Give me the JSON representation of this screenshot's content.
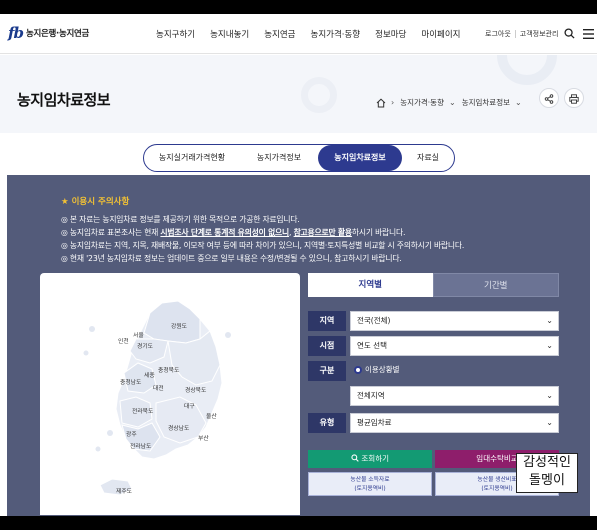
{
  "header": {
    "logo_mark": "fb",
    "logo_text": "농지은행·농지연금",
    "nav": [
      "농지구하기",
      "농지내놓기",
      "농지연금",
      "농지가격·동향",
      "정보마당",
      "마이페이지"
    ],
    "util": {
      "login": "로그아웃",
      "customer": "고객정보관리"
    }
  },
  "page": {
    "title": "농지임차료정보",
    "breadcrumb": [
      "농지가격·동향",
      "농지임차료정보"
    ]
  },
  "tabs": [
    {
      "label": "농지실거래가격현황",
      "active": false
    },
    {
      "label": "농지가격정보",
      "active": false
    },
    {
      "label": "농지임차료정보",
      "active": true
    },
    {
      "label": "자료실",
      "active": false
    }
  ],
  "notice": {
    "title": "★ 이용시 주의사항",
    "lines": [
      {
        "pre": "본 자료는 농지임차료 정보를 제공하기 위한 목적으로 가공한 자료입니다.",
        "u1": "",
        "mid": "",
        "u2": "",
        "post": ""
      },
      {
        "pre": "농지임차료 표본조사는 현재 ",
        "u1": "시범조사 단계로 통계적 유의성이 없으니",
        "mid": ", ",
        "u2": "참고용으로만 활용",
        "post": "하시기 바랍니다."
      },
      {
        "pre": "농지임차료는 지역, 지목, 재배작물, 이모작 여부 등에 따라 차이가 있으니, 지역별·토지특성별 비교할 시 주의하시기 바랍니다.",
        "u1": "",
        "mid": "",
        "u2": "",
        "post": ""
      },
      {
        "pre": "현재 '23년 농지임차료 정보는 업데이트 중으로 일부 내용은 수정/변경될 수 있으니, 참고하시기 바랍니다.",
        "u1": "",
        "mid": "",
        "u2": "",
        "post": ""
      }
    ]
  },
  "map": {
    "regions": [
      "경기도",
      "서울",
      "인천",
      "강원도",
      "충청북도",
      "충청남도",
      "세종",
      "대전",
      "경상북도",
      "대구",
      "울산",
      "전라북도",
      "경상남도",
      "부산",
      "광주",
      "전라남도",
      "제주도"
    ]
  },
  "form": {
    "view_tabs": [
      {
        "label": "지역별",
        "active": true
      },
      {
        "label": "기간별",
        "active": false
      }
    ],
    "region_label": "지역",
    "region_value": "전국(전체)",
    "period_label": "시점",
    "period_value": "연도 선택",
    "type_label": "구분",
    "type_radio": "이용상황별",
    "type_value": "전체지역",
    "kind_label": "유형",
    "kind_value": "평균임차료",
    "search_button": "조회하기",
    "compare_button": "임대수탁비교",
    "sub_buttons": [
      {
        "line1": "농산물 소득자료",
        "line2": "(토지용역비)"
      },
      {
        "line1": "농산물 생산비표",
        "line2": "(토지용역비)"
      }
    ]
  },
  "overlay": {
    "line1": "감성적인",
    "line2": "돌멩이"
  },
  "colors": {
    "primary": "#2d3a8f",
    "panel": "#535b7a",
    "search": "#139a73",
    "compare": "#8e1e6b",
    "notice_title": "#f3c234"
  }
}
